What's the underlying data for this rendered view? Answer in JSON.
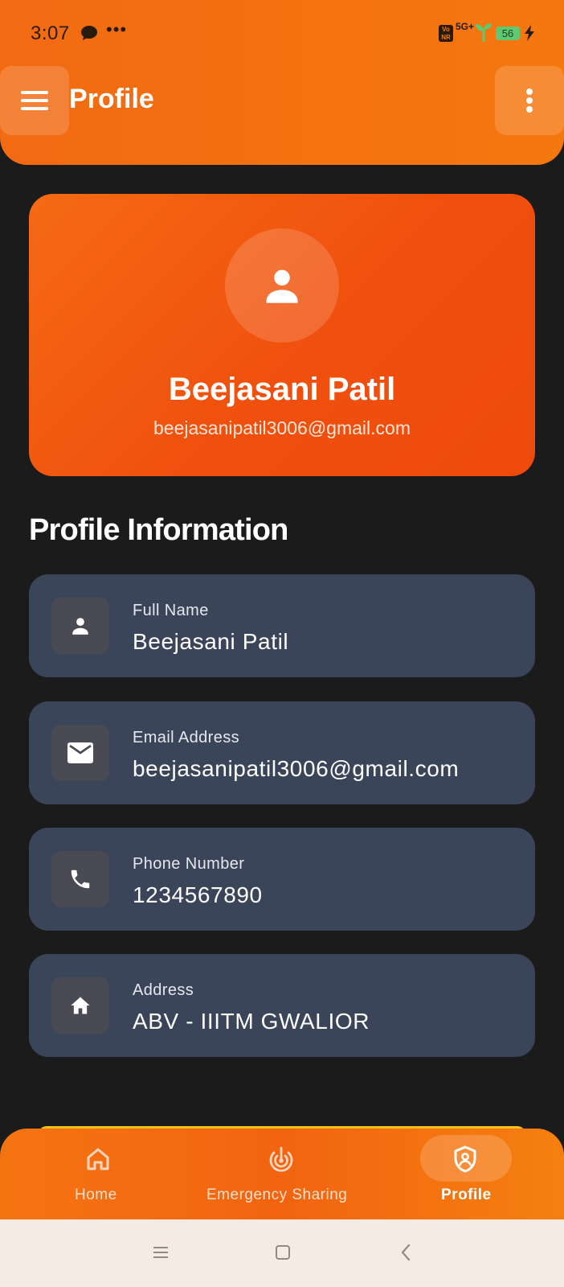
{
  "status_bar": {
    "time": "3:07",
    "dots": "•••",
    "volte": "Vo\nNR",
    "network": "5G+",
    "battery": "56"
  },
  "header": {
    "title": "Profile"
  },
  "profile_card": {
    "name": "Beejasani Patil",
    "email": "beejasanipatil3006@gmail.com"
  },
  "section": {
    "title": "Profile Information"
  },
  "info_items": [
    {
      "label": "Full Name",
      "value": "Beejasani Patil",
      "icon": "person-icon"
    },
    {
      "label": "Email Address",
      "value": "beejasanipatil3006@gmail.com",
      "icon": "mail-icon"
    },
    {
      "label": "Phone Number",
      "value": "1234567890",
      "icon": "phone-icon"
    },
    {
      "label": "Address",
      "value": "ABV - IIITM GWALIOR",
      "icon": "home-icon"
    }
  ],
  "bottom_nav": {
    "items": [
      {
        "label": "Home",
        "icon": "home-outline-icon",
        "active": false
      },
      {
        "label": "Emergency Sharing",
        "icon": "radar-icon",
        "active": false
      },
      {
        "label": "Profile",
        "icon": "shield-person-icon",
        "active": true
      }
    ]
  },
  "colors": {
    "accent": "#f26a12",
    "card_bg": "#3b4559",
    "page_bg": "#1b1b1b"
  }
}
